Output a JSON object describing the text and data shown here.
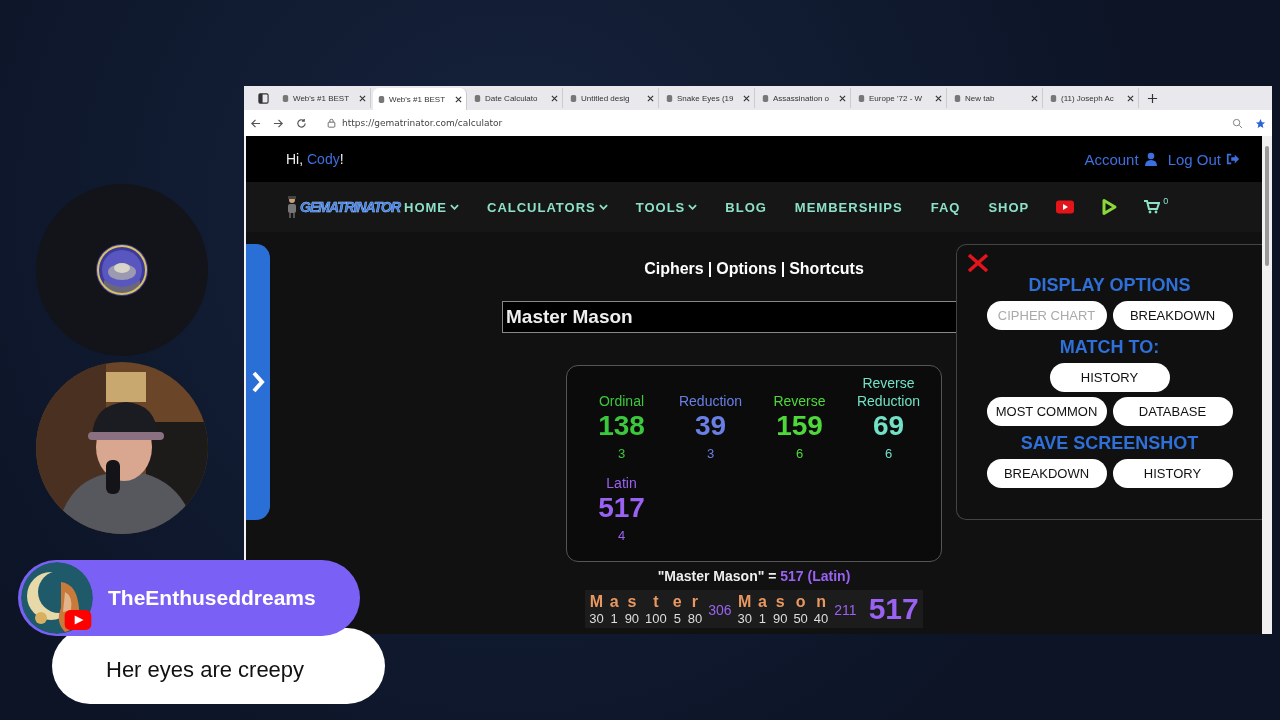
{
  "browser": {
    "tabs": [
      {
        "title": "Web's #1 BEST",
        "selected": false
      },
      {
        "title": "Web's #1 BEST",
        "selected": true
      },
      {
        "title": "Date Calculato",
        "selected": false
      },
      {
        "title": "Untitled desig",
        "selected": false
      },
      {
        "title": "Snake Eyes (19",
        "selected": false
      },
      {
        "title": "Assassination o",
        "selected": false
      },
      {
        "title": "Europe '72 - W",
        "selected": false
      },
      {
        "title": "New tab",
        "selected": false
      },
      {
        "title": "(11) Joseph Ac",
        "selected": false
      }
    ],
    "address": "https://gematrinator.com/calculator"
  },
  "site": {
    "greeting": "Hi, ",
    "user": "Cody",
    "greeting_end": "!",
    "account": "Account",
    "logout": "Log Out",
    "logo_text": "GEMATRINATOR",
    "nav": [
      {
        "label": "HOME",
        "dropdown": true
      },
      {
        "label": "CALCULATORS",
        "dropdown": true
      },
      {
        "label": "TOOLS",
        "dropdown": true
      },
      {
        "label": "BLOG",
        "dropdown": false
      },
      {
        "label": "MEMBERSHIPS",
        "dropdown": false
      },
      {
        "label": "FAQ",
        "dropdown": false
      },
      {
        "label": "SHOP",
        "dropdown": false
      }
    ],
    "cart_count": "0"
  },
  "calculator": {
    "menu": [
      "Ciphers",
      "Options",
      "Shortcuts"
    ],
    "separator": "|",
    "input": "Master Mason",
    "ciphers": [
      {
        "name": "Ordinal",
        "value": "138",
        "count": "3",
        "color": "#3cc83c"
      },
      {
        "name": "Reduction",
        "value": "39",
        "count": "3",
        "color": "#6a7fe6"
      },
      {
        "name": "Reverse",
        "value": "159",
        "count": "6",
        "color": "#4ed83a"
      },
      {
        "name": "Reverse Reduction",
        "value": "69",
        "count": "6",
        "color": "#72e2c6"
      },
      {
        "name": "Latin",
        "value": "517",
        "count": "4",
        "color": "#9a62f2"
      }
    ],
    "summary": {
      "phrase": "\"Master Mason\" =",
      "result": "517 (Latin)"
    },
    "breakdown": {
      "words": [
        {
          "letters": [
            {
              "char": "M",
              "value": "30"
            },
            {
              "char": "a",
              "value": "1"
            },
            {
              "char": "s",
              "value": "90"
            },
            {
              "char": "t",
              "value": "100"
            },
            {
              "char": "e",
              "value": "5"
            },
            {
              "char": "r",
              "value": "80"
            }
          ],
          "total": "306"
        },
        {
          "letters": [
            {
              "char": "M",
              "value": "30"
            },
            {
              "char": "a",
              "value": "1"
            },
            {
              "char": "s",
              "value": "90"
            },
            {
              "char": "o",
              "value": "50"
            },
            {
              "char": "n",
              "value": "40"
            }
          ],
          "total": "211"
        }
      ],
      "total": "517"
    }
  },
  "options_panel": {
    "sections": [
      {
        "heading": "DISPLAY OPTIONS",
        "rows": [
          [
            {
              "label": "CIPHER CHART",
              "disabled": true
            },
            {
              "label": "BREAKDOWN",
              "disabled": false
            }
          ]
        ]
      },
      {
        "heading": "MATCH TO:",
        "rows": [
          [
            {
              "label": "HISTORY",
              "disabled": false
            }
          ],
          [
            {
              "label": "MOST COMMON",
              "disabled": false
            },
            {
              "label": "DATABASE",
              "disabled": false
            }
          ]
        ]
      },
      {
        "heading": "SAVE SCREENSHOT",
        "rows": [
          [
            {
              "label": "BREAKDOWN",
              "disabled": false
            },
            {
              "label": "HISTORY",
              "disabled": false
            }
          ]
        ]
      }
    ]
  },
  "chat": {
    "author": "TheEnthuseddreams",
    "message": "Her eyes are creepy"
  }
}
